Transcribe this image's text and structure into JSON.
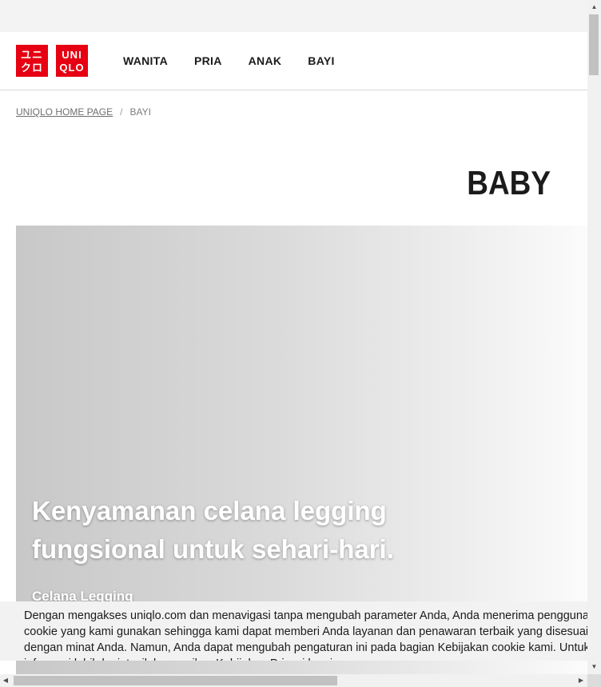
{
  "header": {
    "logo_primary_row1": "ユニ",
    "logo_primary_row2": "クロ",
    "logo_secondary_row1": "UNI",
    "logo_secondary_row2": "QLO",
    "nav": [
      {
        "label": "WANITA"
      },
      {
        "label": "PRIA"
      },
      {
        "label": "ANAK"
      },
      {
        "label": "BAYI"
      }
    ]
  },
  "breadcrumb": {
    "home": "UNIQLO HOME PAGE",
    "separator": "/",
    "current": "BAYI"
  },
  "page_title": "BABY",
  "hero": {
    "headline": "Kenyamanan celana legging fungsional untuk sehari-hari.",
    "subtitle": "Celana Legging"
  },
  "cookie_notice": {
    "text": "Dengan mengakses uniqlo.com dan menavigasi tanpa mengubah parameter Anda, Anda menerima penggunaan cookie yang kami gunakan sehingga kami dapat memberi Anda layanan dan penawaran terbaik yang disesuaikan dengan minat Anda. Namun, Anda dapat mengubah pengaturan ini pada bagian Kebijakan cookie kami. Untuk informasi lebih lanjut, silakan periksa Kebijakan Privasi kami."
  },
  "icons": {
    "scroll_up": "triangle-up",
    "scroll_down": "triangle-down",
    "scroll_left": "triangle-left",
    "scroll_right": "triangle-right"
  },
  "colors": {
    "brand_red": "#e60012",
    "text": "#1b1b1b"
  }
}
